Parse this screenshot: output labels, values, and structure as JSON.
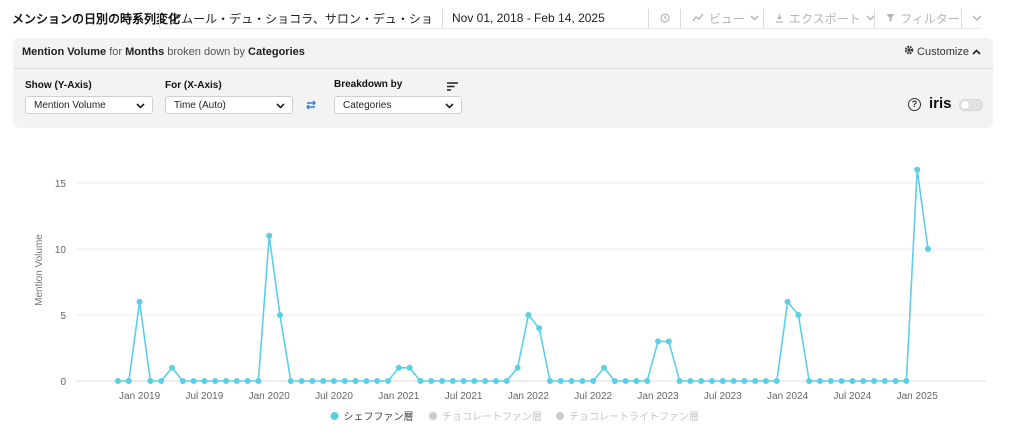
{
  "header": {
    "title": "メンションの日別の時系列変化",
    "keyword": "アムール・デュ・ショコラ、サロン・デュ・ショコラ、...",
    "date_range": "Nov 01, 2018 - Feb 14, 2025",
    "view_label": "ビュー",
    "export_label": "エクスポート",
    "filter_label": "フィルター"
  },
  "panel": {
    "heading": {
      "metric": "Mention Volume",
      "for_word": "for",
      "unit": "Months",
      "broken_word": "broken down by",
      "dimension": "Categories"
    },
    "customize_label": "Customize",
    "show_label": "Show (Y-Axis)",
    "show_value": "Mention Volume",
    "for_label": "For (X-Axis)",
    "for_value": "Time (Auto)",
    "breakdown_label": "Breakdown by",
    "breakdown_value": "Categories",
    "help_glyph": "?",
    "iris_label": "iris",
    "iris_enabled": false
  },
  "colors": {
    "series": "#5ccfe6",
    "muted": "#cccccc"
  },
  "chart_data": {
    "type": "line",
    "ylabel": "Mention Volume",
    "xlabel": "",
    "ylim": [
      0,
      16.5
    ],
    "yticks": [
      0,
      5,
      10,
      15
    ],
    "grid": true,
    "legend_position": "bottom",
    "x": [
      "2018-11",
      "2018-12",
      "2019-01",
      "2019-02",
      "2019-03",
      "2019-04",
      "2019-05",
      "2019-06",
      "2019-07",
      "2019-08",
      "2019-09",
      "2019-10",
      "2019-11",
      "2019-12",
      "2020-01",
      "2020-02",
      "2020-03",
      "2020-04",
      "2020-05",
      "2020-06",
      "2020-07",
      "2020-08",
      "2020-09",
      "2020-10",
      "2020-11",
      "2020-12",
      "2021-01",
      "2021-02",
      "2021-03",
      "2021-04",
      "2021-05",
      "2021-06",
      "2021-07",
      "2021-08",
      "2021-09",
      "2021-10",
      "2021-11",
      "2021-12",
      "2022-01",
      "2022-02",
      "2022-03",
      "2022-04",
      "2022-05",
      "2022-06",
      "2022-07",
      "2022-08",
      "2022-09",
      "2022-10",
      "2022-11",
      "2022-12",
      "2023-01",
      "2023-02",
      "2023-03",
      "2023-04",
      "2023-05",
      "2023-06",
      "2023-07",
      "2023-08",
      "2023-09",
      "2023-10",
      "2023-11",
      "2023-12",
      "2024-01",
      "2024-02",
      "2024-03",
      "2024-04",
      "2024-05",
      "2024-06",
      "2024-07",
      "2024-08",
      "2024-09",
      "2024-10",
      "2024-11",
      "2024-12",
      "2025-01",
      "2025-02"
    ],
    "x_tick_labels": [
      "Jan 2019",
      "Jul 2019",
      "Jan 2020",
      "Jul 2020",
      "Jan 2021",
      "Jul 2021",
      "Jan 2022",
      "Jul 2022",
      "Jan 2023",
      "Jul 2023",
      "Jan 2024",
      "Jul 2024",
      "Jan 2025"
    ],
    "series": [
      {
        "name": "シェフファン層",
        "active": true,
        "values": [
          0,
          0,
          6,
          0,
          0,
          1,
          0,
          0,
          0,
          0,
          0,
          0,
          0,
          0,
          11,
          5,
          0,
          0,
          0,
          0,
          0,
          0,
          0,
          0,
          0,
          0,
          1,
          1,
          0,
          0,
          0,
          0,
          0,
          0,
          0,
          0,
          0,
          1,
          5,
          4,
          0,
          0,
          0,
          0,
          0,
          1,
          0,
          0,
          0,
          0,
          3,
          3,
          0,
          0,
          0,
          0,
          0,
          0,
          0,
          0,
          0,
          0,
          6,
          5,
          0,
          0,
          0,
          0,
          0,
          0,
          0,
          0,
          0,
          0,
          16,
          10
        ]
      },
      {
        "name": "チョコレートファン層",
        "active": false,
        "values": []
      },
      {
        "name": "チョコレートライトファン層",
        "active": false,
        "values": []
      }
    ]
  }
}
